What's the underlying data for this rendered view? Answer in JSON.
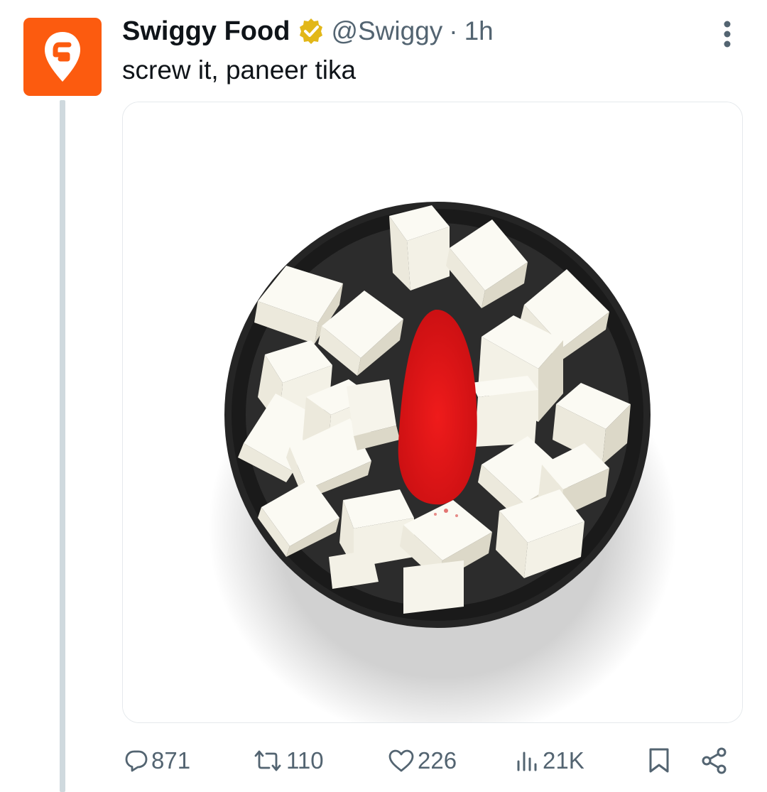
{
  "tweet": {
    "author": {
      "display_name": "Swiggy Food",
      "handle": "@Swiggy",
      "verified": true,
      "avatar_icon": "swiggy-logo-icon",
      "avatar_color": "#fc5b0f"
    },
    "separator": "·",
    "timestamp": "1h",
    "text": "screw it, paneer tika",
    "media": {
      "description_icon": "paneer-bowl-photo"
    },
    "actions": {
      "reply": {
        "icon": "comment-icon",
        "count": "871"
      },
      "retweet": {
        "icon": "retweet-icon",
        "count": "110"
      },
      "like": {
        "icon": "heart-icon",
        "count": "226"
      },
      "views": {
        "icon": "views-chart-icon",
        "count": "21K"
      },
      "bookmark": {
        "icon": "bookmark-icon"
      },
      "share": {
        "icon": "share-icon"
      }
    }
  },
  "colors": {
    "verified_badge": "#e2b719",
    "secondary_text": "#536471",
    "thread_line": "#cfd9de",
    "tika_red": "#e01a1a"
  }
}
